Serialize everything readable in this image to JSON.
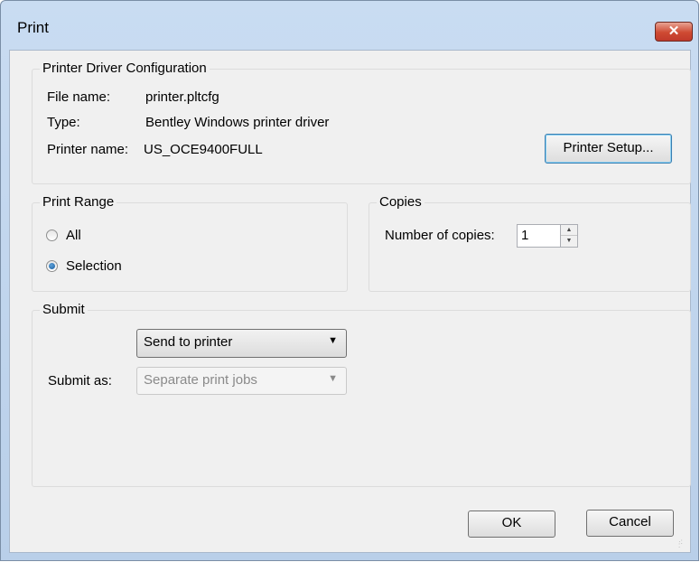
{
  "window": {
    "title": "Print",
    "close_label": "✕"
  },
  "driver_config": {
    "legend": "Printer Driver Configuration",
    "file_name_label": "File name:",
    "file_name_value": "printer.pltcfg",
    "type_label": "Type:",
    "type_value": "Bentley Windows printer driver",
    "printer_name_label": "Printer name:",
    "printer_name_value": "US_OCE9400FULL",
    "setup_button": "Printer Setup..."
  },
  "print_range": {
    "legend": "Print Range",
    "options": [
      {
        "label": "All",
        "selected": false
      },
      {
        "label": "Selection",
        "selected": true
      }
    ]
  },
  "copies": {
    "legend": "Copies",
    "label": "Number of copies:",
    "value": "1"
  },
  "submit": {
    "legend": "Submit",
    "destination": "Send to printer",
    "submit_as_label": "Submit as:",
    "submit_as_value": "Separate print jobs",
    "submit_as_enabled": false
  },
  "footer": {
    "ok_label": "OK",
    "cancel_label": "Cancel"
  },
  "icons": {
    "up": "▲",
    "down": "▼",
    "dropdown": "▼"
  },
  "colors": {
    "close_button": "#c0392b",
    "client_bg": "#f0f0f0",
    "title_bar": "#c9dcf2"
  }
}
